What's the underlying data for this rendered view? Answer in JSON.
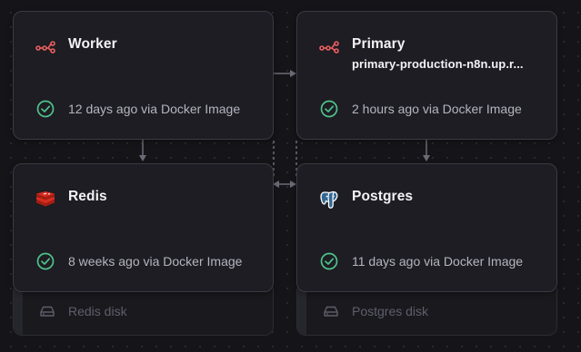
{
  "services": [
    {
      "name": "Worker",
      "subtitle": "",
      "status": "12 days ago via Docker Image",
      "icon": "workflow-icon"
    },
    {
      "name": "Primary",
      "subtitle": "primary-production-n8n.up.r...",
      "status": "2 hours ago via Docker Image",
      "icon": "workflow-icon"
    },
    {
      "name": "Redis",
      "subtitle": "",
      "status": "8 weeks ago via Docker Image",
      "icon": "redis-icon",
      "volume": "Redis disk"
    },
    {
      "name": "Postgres",
      "subtitle": "",
      "status": "11 days ago via Docker Image",
      "icon": "postgres-icon",
      "volume": "Postgres disk"
    }
  ],
  "colors": {
    "background": "#151519",
    "card": "#1d1d23",
    "card_border": "#3a3a44",
    "success": "#4fc28a",
    "n8n_accent": "#ea5f5f",
    "redis": "#d82c20",
    "postgres": "#336791",
    "connector": "#6b6b76"
  }
}
